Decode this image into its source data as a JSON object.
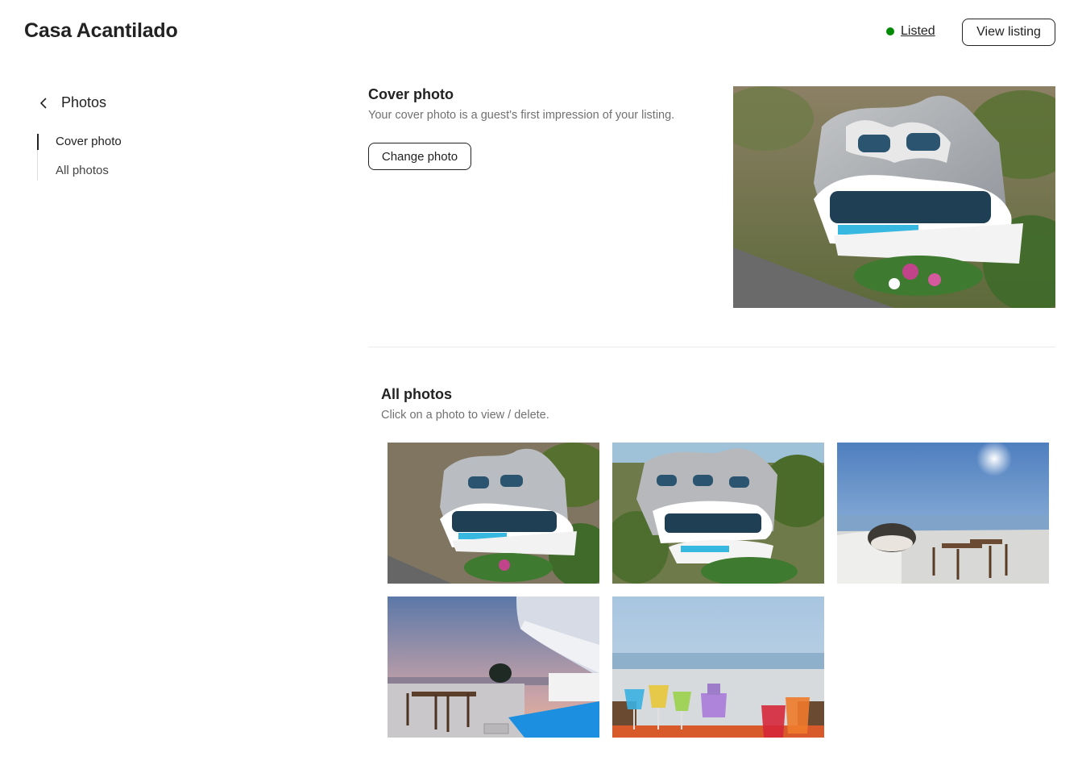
{
  "header": {
    "title": "Casa Acantilado",
    "status_label": "Listed",
    "status_color": "#008a05",
    "view_listing_label": "View listing"
  },
  "sidebar": {
    "back_label": "Photos",
    "back_icon": "chevron-left-icon",
    "items": [
      {
        "label": "Cover photo",
        "active": true
      },
      {
        "label": "All photos",
        "active": false
      }
    ]
  },
  "cover": {
    "title": "Cover photo",
    "subtitle": "Your cover photo is a guest's first impression of your listing.",
    "change_label": "Change photo"
  },
  "all_photos": {
    "title": "All photos",
    "subtitle": "Click on a photo to view / delete.",
    "count": 5
  }
}
